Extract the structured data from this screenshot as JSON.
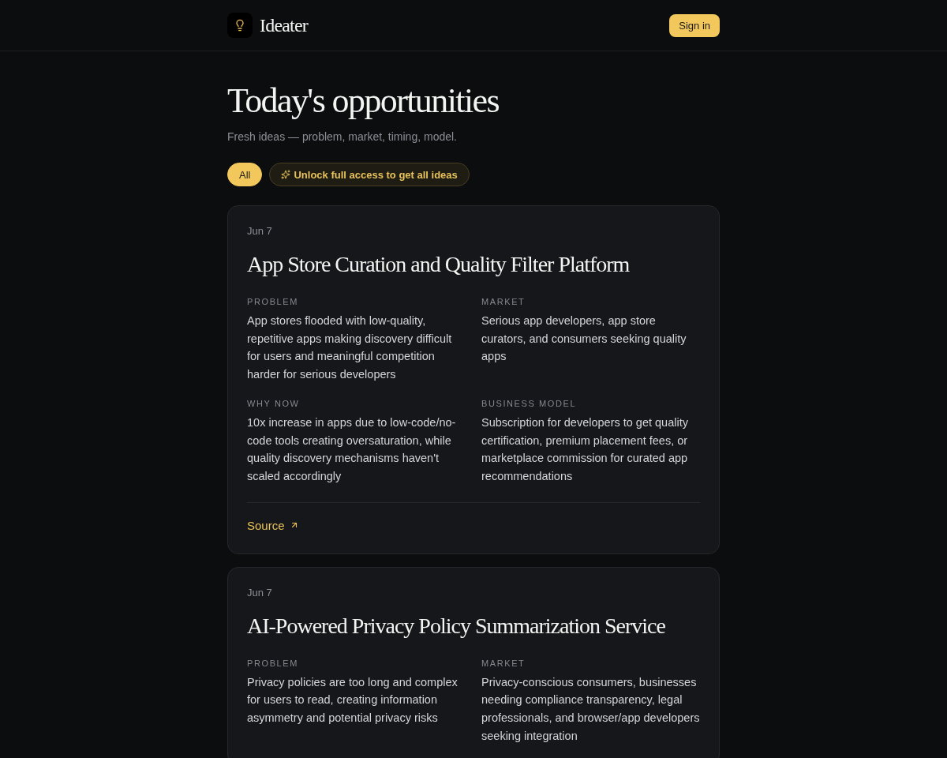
{
  "header": {
    "brand": "Ideater",
    "sign_in": "Sign in"
  },
  "page": {
    "title": "Today's opportunities",
    "subtitle": "Fresh ideas — problem, market, timing, model."
  },
  "filters": [
    {
      "label": "All",
      "selected": true
    }
  ],
  "upgrade": {
    "label": "Unlock full access to get all ideas"
  },
  "ideas": [
    {
      "date": "Jun 7",
      "title": "App Store Curation and Quality Filter Platform",
      "sections": [
        {
          "label": "PROBLEM",
          "text": "App stores flooded with low-quality, repetitive apps making discovery difficult for users and meaningful competition harder for serious developers"
        },
        {
          "label": "MARKET",
          "text": "Serious app developers, app store curators, and consumers seeking quality apps"
        },
        {
          "label": "WHY NOW",
          "text": "10x increase in apps due to low-code/no-code tools creating oversaturation, while quality discovery mechanisms haven't scaled accordingly"
        },
        {
          "label": "BUSINESS MODEL",
          "text": "Subscription for developers to get quality certification, premium placement fees, or marketplace commission for curated app recommendations"
        }
      ],
      "source": "Source"
    },
    {
      "date": "Jun 7",
      "title": "AI-Powered Privacy Policy Summarization Service",
      "sections": [
        {
          "label": "PROBLEM",
          "text": "Privacy policies are too long and complex for users to read, creating information asymmetry and potential privacy risks"
        },
        {
          "label": "MARKET",
          "text": "Privacy-conscious consumers, businesses needing compliance transparency, legal professionals, and browser/app developers seeking integration"
        }
      ]
    }
  ]
}
